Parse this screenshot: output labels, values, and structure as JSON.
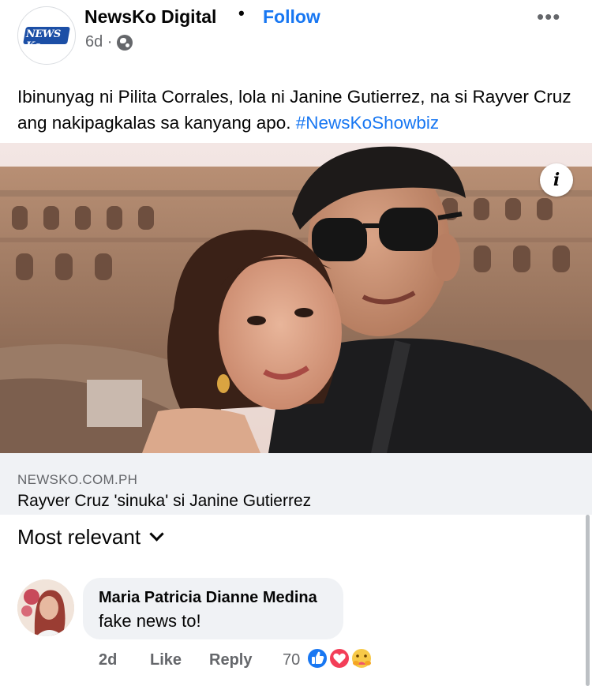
{
  "post": {
    "page_name": "NewsKo Digital",
    "logo_text": "NEWS Ko",
    "separator": "•",
    "follow_label": "Follow",
    "time_ago": "6d ·",
    "more_label": "•••",
    "caption": "Ibinunyag ni Pilita Corrales, lola ni Janine Gutierrez, na si Rayver Cruz ang nakipagkalas sa kanyang apo.",
    "hashtag": "#NewsKoShowbiz",
    "info_label": "i"
  },
  "link": {
    "domain": "NEWSKO.COM.PH",
    "title": "Rayver Cruz 'sinuka' si Janine Gutierrez"
  },
  "comments_section": {
    "sort_label": "Most relevant"
  },
  "comment": {
    "author": "Maria Patricia Dianne Medina",
    "text": "fake news to!",
    "time": "2d",
    "like_label": "Like",
    "reply_label": "Reply",
    "reaction_count": "70"
  },
  "icons": {
    "globe": "globe-icon",
    "more": "more-dots-icon",
    "chevron": "chevron-down-icon",
    "reactions": [
      "like-reaction-icon",
      "love-reaction-icon",
      "care-reaction-icon"
    ]
  },
  "colors": {
    "accent": "#1877f2",
    "secondary_text": "#65676b",
    "bubble_bg": "#f0f2f5"
  }
}
